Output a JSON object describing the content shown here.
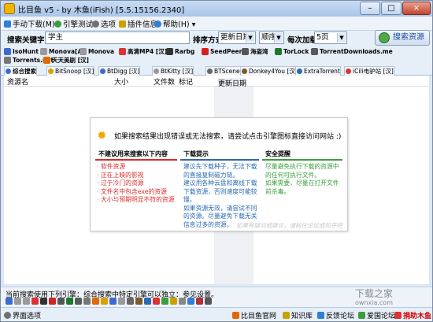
{
  "window": {
    "title": "比目鱼 v5 - by 木鱼(iFish) [5.5.15156.2340]",
    "controls": {
      "minimize": "–",
      "maximize": "□",
      "close": "×"
    }
  },
  "menu": {
    "items": [
      {
        "label": "手动下载(M)",
        "icon": "download-icon",
        "color": "#2e7fd8"
      },
      {
        "label": "引擎测试",
        "icon": "test-icon",
        "color": "#3b9e3b"
      },
      {
        "label": "选项",
        "icon": "gear-icon",
        "color": "#707070"
      },
      {
        "label": "插件信息",
        "icon": "plugin-icon",
        "color": "#c8a200"
      },
      {
        "label": "帮助(H) ▾",
        "icon": "help-icon",
        "color": "#2e7fd8"
      }
    ]
  },
  "search": {
    "keyword_label": "搜索关键字",
    "keyword_value": "学主",
    "sort_label": "排序方式",
    "sort_value": "更新日期",
    "order_value": "顺序",
    "per_load_label": "每次加载",
    "per_load_value": "5页",
    "button_label": "搜索资源"
  },
  "engines": [
    {
      "label": "IsoHunt",
      "color": "#3b6ccf"
    },
    {
      "label": "Monova[A]",
      "color": "#9a9a9a"
    },
    {
      "label": "Monova",
      "color": "#9a9a9a"
    },
    {
      "label": "高清MP4 [汉]",
      "color": "#d33"
    },
    {
      "label": "Rarbg",
      "color": "#333"
    },
    {
      "label": "SeedPeer",
      "color": "#d82020"
    },
    {
      "label": "海盗湾",
      "color": "#555"
    },
    {
      "label": "TorLock",
      "color": "#1b7a2a"
    },
    {
      "label": "TorrentDownloads.me",
      "color": "#5a5a5a"
    },
    {
      "label": "Torrents.net",
      "color": "#777"
    },
    {
      "label": "天天美剧 [汉]",
      "color": "#e06a00"
    }
  ],
  "tabs": [
    {
      "label": "综合搜索",
      "active": true,
      "color": "#3b6ccf"
    },
    {
      "label": "BitSnoop [汉]",
      "active": false,
      "color": "#d8a000"
    },
    {
      "label": "BtDigg [汉]",
      "active": false,
      "color": "#3b6ccf"
    },
    {
      "label": "BtKitty [汉]",
      "active": false,
      "color": "#999"
    },
    {
      "label": "BTScene",
      "active": false,
      "color": "#666"
    },
    {
      "label": "Donkey4You [汉]",
      "active": false,
      "color": "#7b5a2a"
    },
    {
      "label": "ExtraTorrent",
      "active": false,
      "color": "#2a6bb0"
    },
    {
      "label": "iCili电驴站 [汉]",
      "active": false,
      "color": "#d33"
    }
  ],
  "table": {
    "columns": [
      "资源名",
      "大小",
      "文件数",
      "标记",
      "更新日期"
    ]
  },
  "notice": {
    "message": "如果搜索结果出现错误或无法搜索，请尝试点击引擎图标直接访问网站 :)",
    "columns": [
      {
        "title": "不建议用来搜索以下内容",
        "color": "#d92b2b",
        "items": [
          "软件资源",
          "正在上映的影视",
          "过于冷门的资源",
          "文件名中包含exe的资源",
          "大小与预期明显不符的资源"
        ]
      },
      {
        "title": "下载提示",
        "color": "#2a6bb0",
        "items": [
          "建议先下载种子，无法下载的直接复制磁力链。",
          "建议用各种云盘和离线下载下载资源，否则速度可能较慢。",
          "如果资源无效，请尝试不同的资源。尽量避免下载无关信息过多的资源。"
        ]
      },
      {
        "title": "安全提醒",
        "color": "#3b9e3b",
        "items": [
          "尽量避免执行下载的资源中的任何可执行文件。",
          "如果需要，尽量在打开文件前杀毒。"
        ]
      }
    ],
    "footer": "如果有疑问或建议，请前往论坛或知乎吧"
  },
  "bottom": {
    "hint": "当前搜索使用下列引擎：综合搜索中特定引擎可以独立：参见设置。",
    "icon_colors": [
      "#3b6ccf",
      "#9a9a9a",
      "#9a9a9a",
      "#d33",
      "#333",
      "#d82020",
      "#555",
      "#1b7a2a",
      "#5a5a5a",
      "#777",
      "#e06a00",
      "#d8a000",
      "#3b6ccf",
      "#999",
      "#666",
      "#7b5a2a",
      "#2a6bb0",
      "#d33",
      "#3b9e3b",
      "#c8a200",
      "#888",
      "#2e7fd8",
      "#a33",
      "#555"
    ]
  },
  "watermark": {
    "line1": "下载之家",
    "line2": "ownxia.com"
  },
  "status": {
    "options_label": "界面选项",
    "options_icon": "gear-icon",
    "links": [
      {
        "label": "比目鱼官网",
        "icon": "home-icon",
        "color": "#e06a00"
      },
      {
        "label": "知识库",
        "icon": "book-icon",
        "color": "#c8a200"
      },
      {
        "label": "反馈论坛",
        "icon": "forum-icon",
        "color": "#2e7fd8"
      },
      {
        "label": "爱国论坛",
        "icon": "flag-icon",
        "color": "#3b9e3b"
      },
      {
        "label": "捐助木鱼",
        "icon": "donate-icon",
        "color": "#d33"
      }
    ]
  }
}
